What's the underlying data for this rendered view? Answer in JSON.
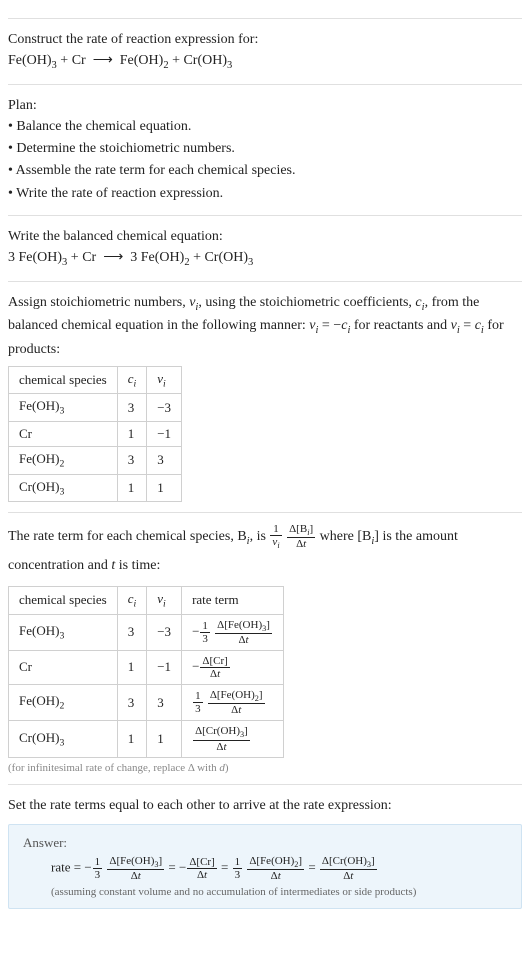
{
  "header": {
    "prompt": "Construct the rate of reaction expression for:",
    "equation_html": "Fe(OH)<sub>3</sub> + Cr &nbsp;⟶&nbsp; Fe(OH)<sub>2</sub> + Cr(OH)<sub>3</sub>"
  },
  "plan": {
    "label": "Plan:",
    "items": [
      "• Balance the chemical equation.",
      "• Determine the stoichiometric numbers.",
      "• Assemble the rate term for each chemical species.",
      "• Write the rate of reaction expression."
    ]
  },
  "balanced": {
    "label": "Write the balanced chemical equation:",
    "equation_html": "3 Fe(OH)<sub>3</sub> + Cr &nbsp;⟶&nbsp; 3 Fe(OH)<sub>2</sub> + Cr(OH)<sub>3</sub>"
  },
  "stoich": {
    "intro_html": "Assign stoichiometric numbers, <i>ν<sub>i</sub></i>, using the stoichiometric coefficients, <i>c<sub>i</sub></i>, from the balanced chemical equation in the following manner: <i>ν<sub>i</sub></i> = −<i>c<sub>i</sub></i> for reactants and <i>ν<sub>i</sub></i> = <i>c<sub>i</sub></i> for products:",
    "headers": {
      "species": "chemical species",
      "ci_html": "<i>c<sub>i</sub></i>",
      "vi_html": "<i>ν<sub>i</sub></i>"
    },
    "rows": [
      {
        "species_html": "Fe(OH)<sub>3</sub>",
        "ci": "3",
        "vi": "−3"
      },
      {
        "species_html": "Cr",
        "ci": "1",
        "vi": "−1"
      },
      {
        "species_html": "Fe(OH)<sub>2</sub>",
        "ci": "3",
        "vi": "3"
      },
      {
        "species_html": "Cr(OH)<sub>3</sub>",
        "ci": "1",
        "vi": "1"
      }
    ]
  },
  "rate_term": {
    "intro_html": "The rate term for each chemical species, B<sub><i>i</i></sub>, is <span class=\"frac inline-mid\"><span class=\"num\">1</span><span class=\"den\"><i>ν<sub>i</sub></i></span></span> <span class=\"frac inline-mid\"><span class=\"num\">Δ[B<sub><i>i</i></sub>]</span><span class=\"den\">Δ<i>t</i></span></span> where [B<sub><i>i</i></sub>] is the amount concentration and <i>t</i> is time:",
    "headers": {
      "species": "chemical species",
      "ci_html": "<i>c<sub>i</sub></i>",
      "vi_html": "<i>ν<sub>i</sub></i>",
      "rate": "rate term"
    },
    "rows": [
      {
        "species_html": "Fe(OH)<sub>3</sub>",
        "ci": "3",
        "vi": "−3",
        "rate_html": "−<span class=\"frac inline-mid\"><span class=\"num\">1</span><span class=\"den\">3</span></span> <span class=\"frac inline-mid\"><span class=\"num\">Δ[Fe(OH)<sub>3</sub>]</span><span class=\"den\">Δ<i>t</i></span></span>"
      },
      {
        "species_html": "Cr",
        "ci": "1",
        "vi": "−1",
        "rate_html": "−<span class=\"frac inline-mid\"><span class=\"num\">Δ[Cr]</span><span class=\"den\">Δ<i>t</i></span></span>"
      },
      {
        "species_html": "Fe(OH)<sub>2</sub>",
        "ci": "3",
        "vi": "3",
        "rate_html": "<span class=\"frac inline-mid\"><span class=\"num\">1</span><span class=\"den\">3</span></span> <span class=\"frac inline-mid\"><span class=\"num\">Δ[Fe(OH)<sub>2</sub>]</span><span class=\"den\">Δ<i>t</i></span></span>"
      },
      {
        "species_html": "Cr(OH)<sub>3</sub>",
        "ci": "1",
        "vi": "1",
        "rate_html": "<span class=\"frac inline-mid\"><span class=\"num\">Δ[Cr(OH)<sub>3</sub>]</span><span class=\"den\">Δ<i>t</i></span></span>"
      }
    ],
    "caption_html": "(for infinitesimal rate of change, replace Δ with <i>d</i>)"
  },
  "final": {
    "intro": "Set the rate terms equal to each other to arrive at the rate expression:",
    "answer_label": "Answer:",
    "equation_html": "rate = −<span class=\"frac inline-mid\"><span class=\"num\">1</span><span class=\"den\">3</span></span> <span class=\"frac inline-mid\"><span class=\"num\">Δ[Fe(OH)<sub>3</sub>]</span><span class=\"den\">Δ<i>t</i></span></span> = −<span class=\"frac inline-mid\"><span class=\"num\">Δ[Cr]</span><span class=\"den\">Δ<i>t</i></span></span> = <span class=\"frac inline-mid\"><span class=\"num\">1</span><span class=\"den\">3</span></span> <span class=\"frac inline-mid\"><span class=\"num\">Δ[Fe(OH)<sub>2</sub>]</span><span class=\"den\">Δ<i>t</i></span></span> = <span class=\"frac inline-mid\"><span class=\"num\">Δ[Cr(OH)<sub>3</sub>]</span><span class=\"den\">Δ<i>t</i></span></span>",
    "note": "(assuming constant volume and no accumulation of intermediates or side products)"
  }
}
